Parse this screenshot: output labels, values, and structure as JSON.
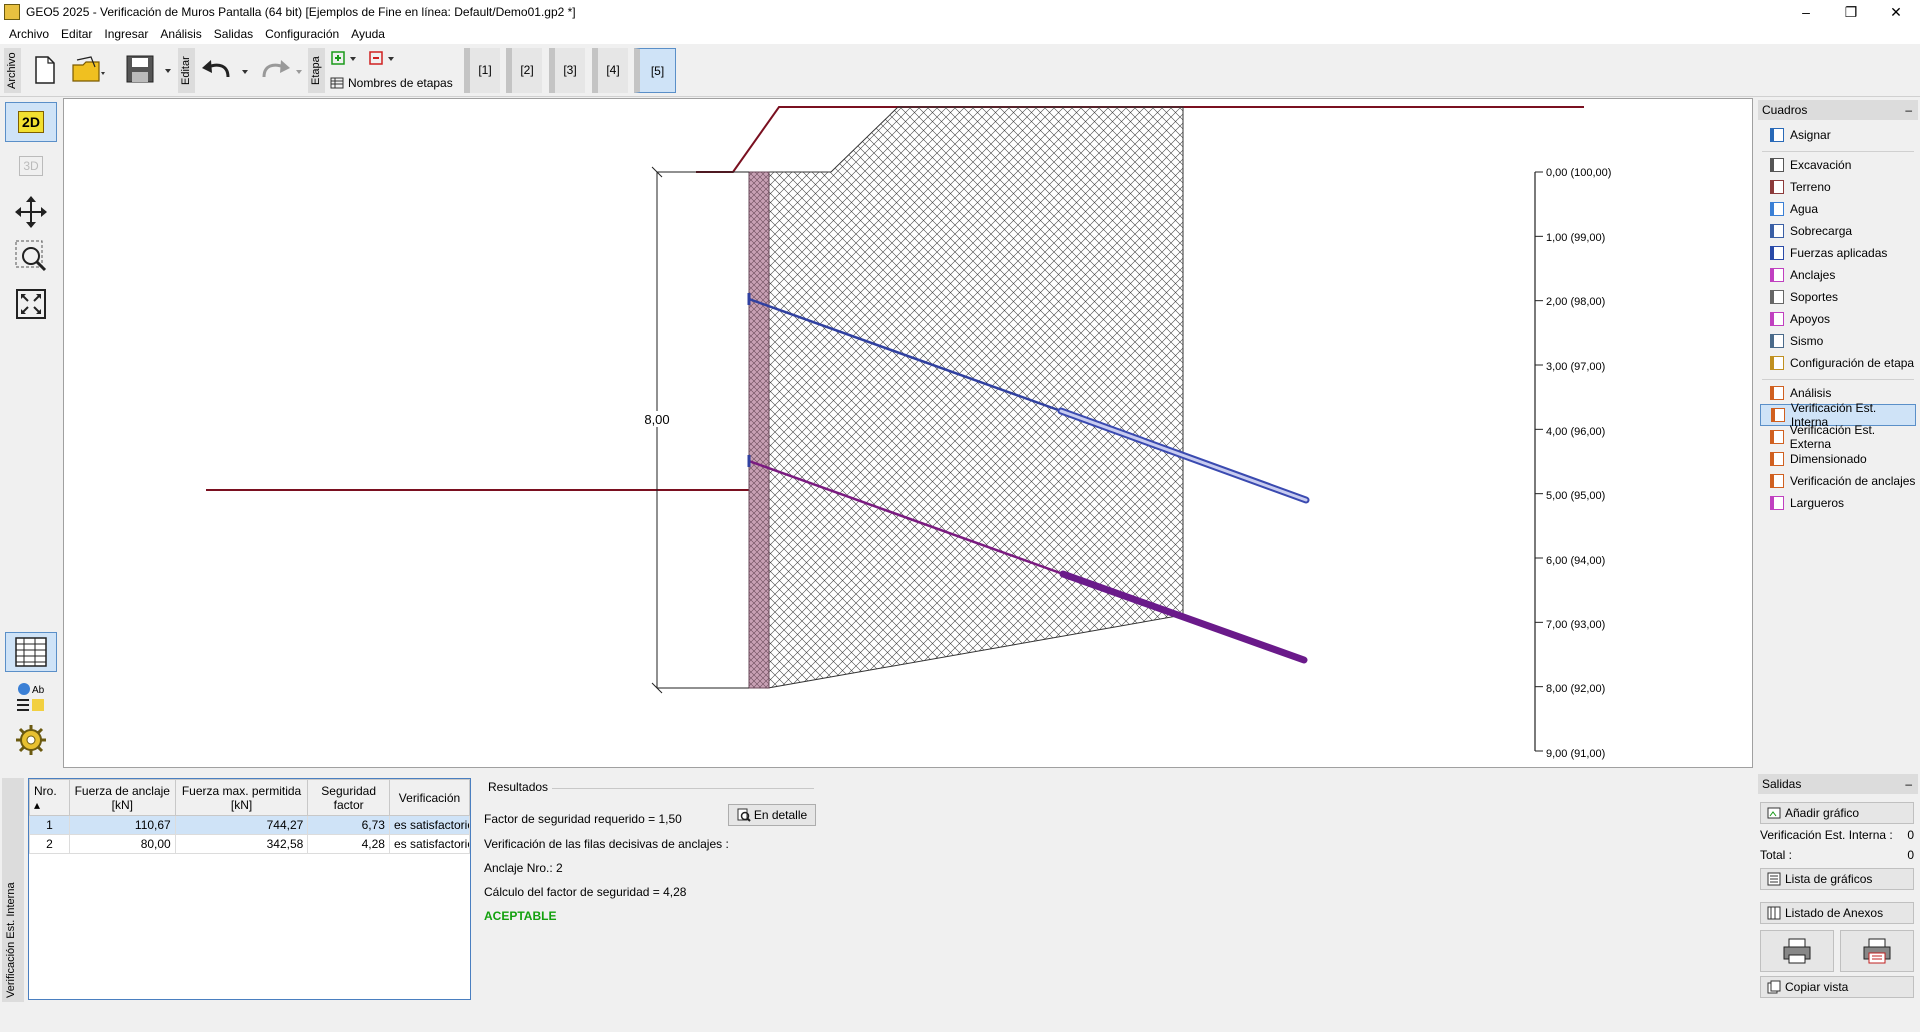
{
  "window": {
    "title": "GEO5 2025 - Verificación de Muros Pantalla (64 bit) [Ejemplos de Fine en línea: Default/Demo01.gp2 *]",
    "minimize": "–",
    "restore": "❐",
    "close": "✕"
  },
  "menu": [
    "Archivo",
    "Editar",
    "Ingresar",
    "Análisis",
    "Salidas",
    "Configuración",
    "Ayuda"
  ],
  "toolbar": {
    "archivo_label": "Archivo",
    "editar_label": "Editar",
    "etapa_label": "Etapa",
    "stage_names_label": "Nombres de etapas",
    "stages": [
      "[1]",
      "[2]",
      "[3]",
      "[4]",
      "[5]"
    ],
    "active_stage": "[5]"
  },
  "left_tools": {
    "view_2d": "2D",
    "view_3d": "3D"
  },
  "drawing": {
    "dimension_label": "8,00",
    "axis_labels": [
      "0,00 (100,00)",
      "1,00 (99,00)",
      "2,00 (98,00)",
      "3,00 (97,00)",
      "4,00 (96,00)",
      "5,00 (95,00)",
      "6,00 (94,00)",
      "7,00 (93,00)",
      "8,00 (92,00)",
      "9,00 (91,00)"
    ]
  },
  "cuadros": {
    "title": "Cuadros",
    "minimize": "–",
    "items": [
      {
        "label": "Asignar",
        "color": "#2a6ab8"
      },
      {
        "label": "Excavación",
        "color": "#555"
      },
      {
        "label": "Terreno",
        "color": "#8b3a3a"
      },
      {
        "label": "Agua",
        "color": "#3a7fd5"
      },
      {
        "label": "Sobrecarga",
        "color": "#3a5fa5"
      },
      {
        "label": "Fuerzas aplicadas",
        "color": "#2a4aa8"
      },
      {
        "label": "Anclajes",
        "color": "#c040c0"
      },
      {
        "label": "Soportes",
        "color": "#666"
      },
      {
        "label": "Apoyos",
        "color": "#c040c0"
      },
      {
        "label": "Sismo",
        "color": "#4a6a8a"
      },
      {
        "label": "Configuración de etapa",
        "color": "#c09020"
      },
      {
        "label": "Análisis",
        "color": "#d06020"
      },
      {
        "label": "Verificación Est. Interna",
        "color": "#d06020"
      },
      {
        "label": "Verificación Est. Externa",
        "color": "#d06020"
      },
      {
        "label": "Dimensionado",
        "color": "#d06020"
      },
      {
        "label": "Verificación de anclajes",
        "color": "#d06020"
      },
      {
        "label": "Largueros",
        "color": "#c040c0"
      }
    ]
  },
  "bottom": {
    "tab_label": "Verificación Est. Interna",
    "table": {
      "headers": [
        [
          "Nro.",
          ""
        ],
        [
          "Fuerza de anclaje",
          "[kN]"
        ],
        [
          "Fuerza max. permitida",
          "[kN]"
        ],
        [
          "Seguridad",
          "factor"
        ],
        [
          "Verificación",
          ""
        ]
      ],
      "rows": [
        [
          "1",
          "110,67",
          "744,27",
          "6,73",
          "es satisfactorio"
        ],
        [
          "2",
          "80,00",
          "342,58",
          "4,28",
          "es satisfactorio"
        ]
      ]
    },
    "results": {
      "legend": "Resultados",
      "required_factor": "Factor de seguridad requerido = 1,50",
      "detail_button": "En detalle",
      "decisive_rows": "Verificación de las filas decisivas de anclajes :",
      "anchor_no": "Anclaje Nro.: 2",
      "computed_factor": "Cálculo del factor de seguridad = 4,28",
      "verdict": "ACEPTABLE"
    }
  },
  "salidas": {
    "title": "Salidas",
    "minimize": "–",
    "add_graphic": "Añadir gráfico",
    "count_label_1": "Verificación Est. Interna :",
    "count_value_1": "0",
    "count_label_2": "Total :",
    "count_value_2": "0",
    "graphics_list": "Lista de gráficos",
    "appendix_list": "Listado de Anexos",
    "copy_view": "Copiar vista"
  }
}
